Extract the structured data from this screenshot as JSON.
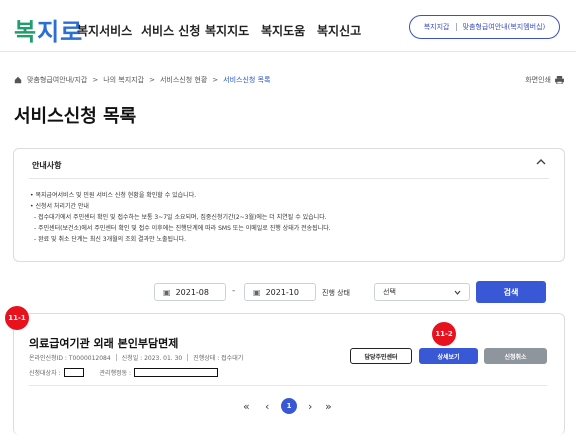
{
  "header": {
    "logo": [
      "복",
      "지로"
    ],
    "nav": [
      "복지서비스",
      "서비스 신청",
      "복지지도",
      "복지도움",
      "복지신고"
    ],
    "pill": [
      "복지지갑",
      "맞춤형급여안내(복지멤버십)"
    ]
  },
  "breadcrumb": {
    "home_icon": "home-icon",
    "items": [
      "맞춤형급여안내/지갑",
      "나의 복지지갑",
      "서비스신청 현황",
      "서비스신청 목록"
    ],
    "separator": ">",
    "print_label": "화면인쇄",
    "print_icon": "printer-icon"
  },
  "page": {
    "title": "서비스신청 목록"
  },
  "notice": {
    "title": "안내사항",
    "lines": [
      "• 복지급여서비스 및 민원 서비스 신청 현황을 확인할 수 있습니다.",
      "• 신청서 처리기간 안내",
      "  - 접수대기에서 주민센터 확인 및 접수하는 보통 3~7일 소요되며, 집중신청기간(2~3월)에는 더 지연될 수 있습니다.",
      "  - 주민센터(보건소)에서 주민센터 확인 및 접수 이후에는 진행단계에 따라 SMS 또는 이메일로 진행 상태가 전송됩니다.",
      "  - 완료 및 취소 단계는 최신 3개월의 조회 결과만 노출됩니다."
    ]
  },
  "filter": {
    "date_from": "2021-08",
    "date_to": "2021-10",
    "dash": "-",
    "status_label": "진행 상태",
    "status_value": "선택",
    "search_label": "검색"
  },
  "result": {
    "title": "의료급여기관 외래 본인부담면제",
    "meta": [
      "온라인신청ID : T0000012084",
      "신청일 : 2023. 01. 30",
      "진행상태 : 접수대기"
    ],
    "applicant_label": "신청대상자 :",
    "org_label": "관리행정동 :",
    "buttons": {
      "center": "담당주민센터",
      "detail": "상세보기",
      "cancel": "신청취소"
    }
  },
  "badges": {
    "left": "11-1",
    "detail": "11-2"
  },
  "pagination": {
    "first": "«",
    "prev": "‹",
    "current": "1",
    "next": "›",
    "last": "»"
  },
  "colors": {
    "accent": "#3858d6",
    "badge": "#e8121e",
    "logo_green": "#1f9e6e",
    "logo_blue": "#2b6fd6"
  }
}
